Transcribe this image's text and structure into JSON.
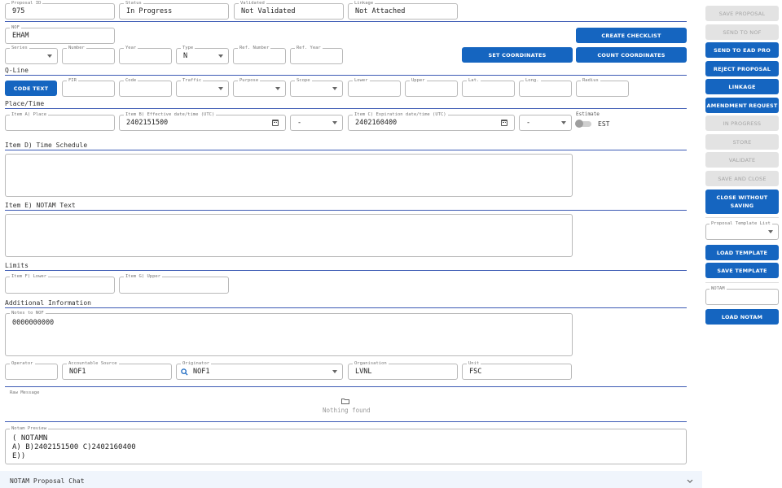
{
  "header": {
    "proposal_id": {
      "label": "Proposal ID",
      "value": "975"
    },
    "status": {
      "label": "Status",
      "value": "In Progress"
    },
    "validated": {
      "label": "Validated",
      "value": "Not Validated"
    },
    "linkage": {
      "label": "Linkage",
      "value": "Not Attached"
    }
  },
  "nof": {
    "label": "NOF",
    "value": "EHAM"
  },
  "series_row": {
    "series": {
      "label": "Series",
      "value": ""
    },
    "number": {
      "label": "Number",
      "value": ""
    },
    "year": {
      "label": "Year",
      "value": ""
    },
    "type": {
      "label": "Type",
      "value": "N"
    },
    "ref_number": {
      "label": "Ref. Number",
      "value": ""
    },
    "ref_year": {
      "label": "Ref. Year",
      "value": ""
    }
  },
  "buttons": {
    "create_checklist": "CREATE CHECKLIST",
    "set_coordinates": "SET COORDINATES",
    "count_coordinates": "COUNT COORDINATES",
    "code_text": "CODE TEXT"
  },
  "qline": {
    "title": "Q-Line",
    "fir": "FIR",
    "code": "Code",
    "traffic": "Traffic",
    "purpose": "Purpose",
    "scope": "Scope",
    "lower": "Lower",
    "upper": "Upper",
    "lat": "Lat.",
    "long": "Long.",
    "radius": "Radius"
  },
  "place_time": {
    "title": "Place/Time",
    "item_a": {
      "label": "Item A) Place",
      "value": ""
    },
    "item_b": {
      "label": "Item B) Effective date/time (UTC)",
      "value": "2402151500"
    },
    "item_b_sel": "-",
    "item_c": {
      "label": "Item C) Expiration date/time (UTC)",
      "value": "2402160400"
    },
    "item_c_sel": "-",
    "estimate": {
      "label": "Estimate",
      "value": "EST"
    }
  },
  "item_d": {
    "title": "Item D) Time Schedule",
    "value": ""
  },
  "item_e": {
    "title": "Item E) NOTAM Text",
    "value": ""
  },
  "limits": {
    "title": "Limits",
    "lower": {
      "label": "Item F) Lower",
      "value": ""
    },
    "upper": {
      "label": "Item G) Upper",
      "value": ""
    }
  },
  "additional": {
    "title": "Additional Information",
    "notes": {
      "label": "Notes to NOF",
      "value": "0000000000"
    },
    "operator": {
      "label": "Operator",
      "value": ""
    },
    "accountable": {
      "label": "Accountable Source",
      "value": "NOF1"
    },
    "originator": {
      "label": "Originator",
      "value": "NOF1"
    },
    "organisation": {
      "label": "Organisation",
      "value": "LVNL"
    },
    "unit": {
      "label": "Unit",
      "value": "FSC"
    }
  },
  "raw_message": {
    "label": "Raw Message",
    "empty_text": "Nothing found"
  },
  "preview": {
    "label": "Notam Preview",
    "text": "( NOTAMN\nA) B)2402151500 C)2402160400\nE))"
  },
  "chat": {
    "title": "NOTAM Proposal Chat"
  },
  "side": {
    "save_proposal": "SAVE PROPOSAL",
    "send_to_nof": "SEND TO NOF",
    "send_to_ead": "SEND TO EAD PRO",
    "reject": "REJECT PROPOSAL",
    "linkage": "LINKAGE",
    "amendment": "AMENDMENT REQUEST",
    "in_progress": "IN PROGRESS",
    "store": "STORE",
    "validate": "VALIDATE",
    "save_close": "SAVE AND CLOSE",
    "close_line1": "CLOSE WITHOUT",
    "close_line2": "SAVING",
    "template_list": {
      "label": "Proposal Template List",
      "value": ""
    },
    "load_template": "LOAD TEMPLATE",
    "save_template": "SAVE TEMPLATE",
    "notam": {
      "label": "NOTAM",
      "value": ""
    },
    "load_notam": "LOAD NOTAM"
  },
  "colors": {
    "accent": "#1565c0",
    "rule": "#3c5ab4",
    "disabled": "#e3e3e3"
  }
}
